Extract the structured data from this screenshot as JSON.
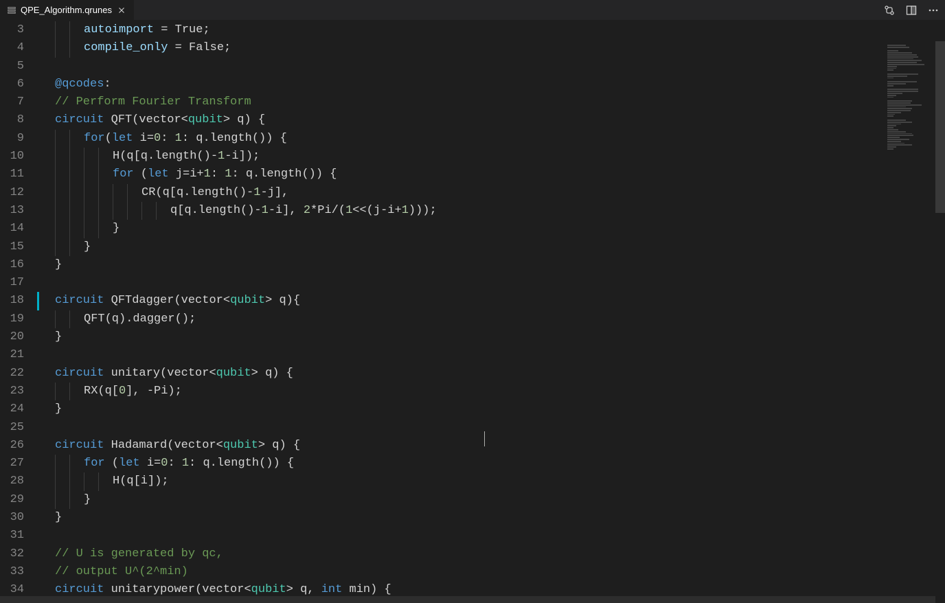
{
  "tab": {
    "filename": "QPE_Algorithm.qrunes"
  },
  "gutter": {
    "start": 3,
    "end": 34
  },
  "code": [
    {
      "n": 3,
      "indent": 2,
      "html": "<span class='pr'>autoimport</span> = True;"
    },
    {
      "n": 4,
      "indent": 2,
      "html": "<span class='pr'>compile_only</span> = False;"
    },
    {
      "n": 5,
      "indent": 0,
      "html": ""
    },
    {
      "n": 6,
      "indent": 0,
      "html": "<span class='k'>@qcodes</span>:"
    },
    {
      "n": 7,
      "indent": 0,
      "html": "<span class='c'>// Perform Fourier Transform</span>"
    },
    {
      "n": 8,
      "indent": 0,
      "html": "<span class='k'>circuit</span> QFT(vector&lt;<span class='t'>qubit</span>&gt; q) {"
    },
    {
      "n": 9,
      "indent": 2,
      "html": "<span class='k'>for</span>(<span class='k'>let</span> i=<span class='n'>0</span>: <span class='n'>1</span>: q.length()) {"
    },
    {
      "n": 10,
      "indent": 4,
      "html": "H(q[q.length()-<span class='n'>1</span>-i]);"
    },
    {
      "n": 11,
      "indent": 4,
      "html": "<span class='k'>for</span> (<span class='k'>let</span> j=i+<span class='n'>1</span>: <span class='n'>1</span>: q.length()) {"
    },
    {
      "n": 12,
      "indent": 6,
      "html": "CR(q[q.length()-<span class='n'>1</span>-j],"
    },
    {
      "n": 13,
      "indent": 8,
      "html": "q[q.length()-<span class='n'>1</span>-i], <span class='n'>2</span>*Pi/(<span class='n'>1</span>&lt;&lt;(j-i+<span class='n'>1</span>)));"
    },
    {
      "n": 14,
      "indent": 4,
      "html": "}"
    },
    {
      "n": 15,
      "indent": 2,
      "html": "}"
    },
    {
      "n": 16,
      "indent": 0,
      "html": "}"
    },
    {
      "n": 17,
      "indent": 0,
      "html": ""
    },
    {
      "n": 18,
      "indent": 0,
      "marker": true,
      "html": "<span class='k'>circuit</span> QFTdagger(vector&lt;<span class='t'>qubit</span>&gt; q){"
    },
    {
      "n": 19,
      "indent": 2,
      "html": "QFT(q).dagger();"
    },
    {
      "n": 20,
      "indent": 0,
      "html": "}"
    },
    {
      "n": 21,
      "indent": 0,
      "html": ""
    },
    {
      "n": 22,
      "indent": 0,
      "html": "<span class='k'>circuit</span> unitary(vector&lt;<span class='t'>qubit</span>&gt; q) {"
    },
    {
      "n": 23,
      "indent": 2,
      "html": "RX(q[<span class='n'>0</span>], -Pi);"
    },
    {
      "n": 24,
      "indent": 0,
      "html": "}"
    },
    {
      "n": 25,
      "indent": 0,
      "html": ""
    },
    {
      "n": 26,
      "indent": 0,
      "html": "<span class='k'>circuit</span> Hadamard(vector&lt;<span class='t'>qubit</span>&gt; q) {"
    },
    {
      "n": 27,
      "indent": 2,
      "html": "<span class='k'>for</span> (<span class='k'>let</span> i=<span class='n'>0</span>: <span class='n'>1</span>: q.length()) {"
    },
    {
      "n": 28,
      "indent": 4,
      "html": "H(q[i]);"
    },
    {
      "n": 29,
      "indent": 2,
      "html": "}"
    },
    {
      "n": 30,
      "indent": 0,
      "html": "}"
    },
    {
      "n": 31,
      "indent": 0,
      "html": ""
    },
    {
      "n": 32,
      "indent": 0,
      "html": "<span class='c'>// U is generated by qc,</span>"
    },
    {
      "n": 33,
      "indent": 0,
      "html": "<span class='c'>// output U^(2^min)</span>"
    },
    {
      "n": 34,
      "indent": 0,
      "html": "<span class='k'>circuit</span> unitarypower(vector&lt;<span class='t'>qubit</span>&gt; q, <span class='k'>int</span> min) {"
    }
  ],
  "minimap_widths": [
    30,
    35,
    0,
    18,
    40,
    48,
    50,
    42,
    55,
    48,
    60,
    16,
    14,
    10,
    0,
    50,
    32,
    10,
    0,
    48,
    30,
    10,
    0,
    50,
    50,
    24,
    14,
    10,
    0,
    40,
    38,
    55,
    30,
    40,
    38,
    22,
    12,
    10,
    0,
    30,
    40,
    22,
    14,
    10,
    18,
    30,
    40,
    42,
    20,
    36,
    22,
    28,
    40,
    14,
    10
  ]
}
